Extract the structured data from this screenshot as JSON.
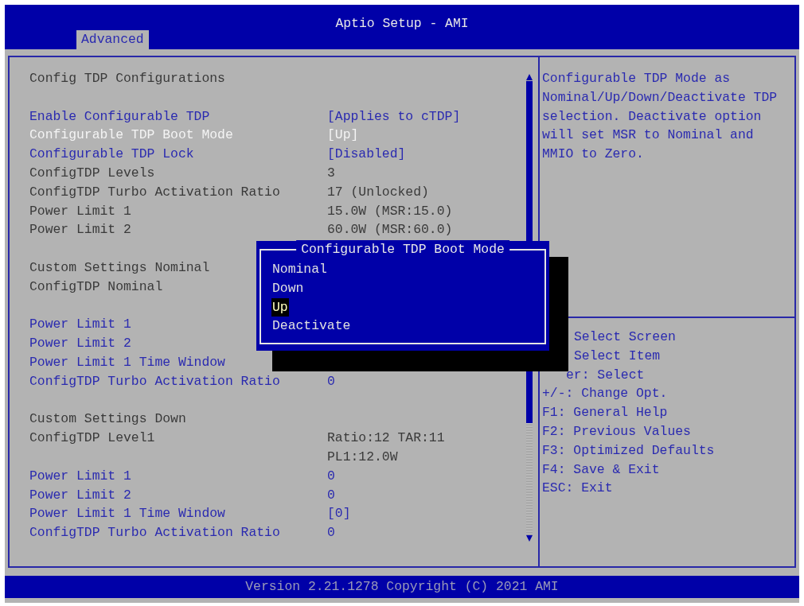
{
  "window": {
    "title": "Aptio Setup - AMI"
  },
  "tabs": [
    {
      "label": "Advanced",
      "selected": true
    }
  ],
  "settings": {
    "groups": [
      {
        "rows": [
          {
            "kind": "title",
            "label": "Config TDP Configurations",
            "selected": false
          }
        ]
      },
      {
        "rows": [
          {
            "kind": "option",
            "label": "Enable Configurable TDP",
            "value": "[Applies to cTDP]",
            "selected": false
          },
          {
            "kind": "option",
            "label": "Configurable TDP Boot Mode",
            "value": "[Up]",
            "selected": true
          },
          {
            "kind": "option",
            "label": "Configurable TDP Lock",
            "value": "[Disabled]",
            "selected": false
          },
          {
            "kind": "info",
            "label": "ConfigTDP Levels",
            "value": "3",
            "selected": false
          },
          {
            "kind": "info",
            "label": "ConfigTDP Turbo Activation Ratio",
            "value": "17 (Unlocked)",
            "selected": false
          },
          {
            "kind": "info",
            "label": "Power Limit 1",
            "value": "15.0W (MSR:15.0)",
            "selected": false
          },
          {
            "kind": "info",
            "label": "Power Limit 2",
            "value": "60.0W (MSR:60.0)",
            "selected": false
          }
        ]
      },
      {
        "rows": [
          {
            "kind": "info",
            "label": "Custom Settings Nominal",
            "selected": false
          },
          {
            "kind": "info",
            "label": "ConfigTDP Nominal",
            "selected": false
          }
        ]
      },
      {
        "rows": [
          {
            "kind": "option",
            "label": "Power Limit 1",
            "selected": false
          },
          {
            "kind": "option",
            "label": "Power Limit 2",
            "selected": false
          },
          {
            "kind": "option",
            "label": "Power Limit 1 Time Window",
            "selected": false
          },
          {
            "kind": "option",
            "label": "ConfigTDP Turbo Activation Ratio",
            "value": "0",
            "selected": false
          }
        ]
      },
      {
        "rows": [
          {
            "kind": "info",
            "label": "Custom Settings Down",
            "selected": false
          },
          {
            "kind": "info",
            "label": "ConfigTDP Level1",
            "value": "Ratio:12 TAR:11",
            "selected": false
          },
          {
            "kind": "info",
            "value": "PL1:12.0W",
            "selected": false
          },
          {
            "kind": "option",
            "label": "Power Limit 1",
            "value": "0",
            "selected": false
          },
          {
            "kind": "option",
            "label": "Power Limit 2",
            "value": "0",
            "selected": false
          },
          {
            "kind": "option",
            "label": "Power Limit 1 Time Window",
            "value": "[0]",
            "selected": false
          },
          {
            "kind": "option",
            "label": "ConfigTDP Turbo Activation Ratio",
            "value": "0",
            "selected": false
          }
        ]
      }
    ]
  },
  "popup": {
    "title": "Configurable TDP Boot Mode",
    "options": [
      {
        "label": "Nominal",
        "selected": false
      },
      {
        "label": "Down",
        "selected": false
      },
      {
        "label": "Up",
        "selected": true
      },
      {
        "label": "Deactivate",
        "selected": false
      }
    ]
  },
  "help": {
    "text": "Configurable TDP Mode as Nominal/Up/Down/Deactivate TDP selection. Deactivate option will set MSR to Nominal and MMIO to Zero."
  },
  "keys": [
    "Select Screen",
    "Select Item",
    "er: Select",
    "+/-: Change Opt.",
    "F1: General Help",
    "F2: Previous Values",
    "F3: Optimized Defaults",
    "F4: Save & Exit",
    "ESC: Exit"
  ],
  "footer": {
    "text": "Version 2.21.1278 Copyright (C) 2021 AMI"
  }
}
